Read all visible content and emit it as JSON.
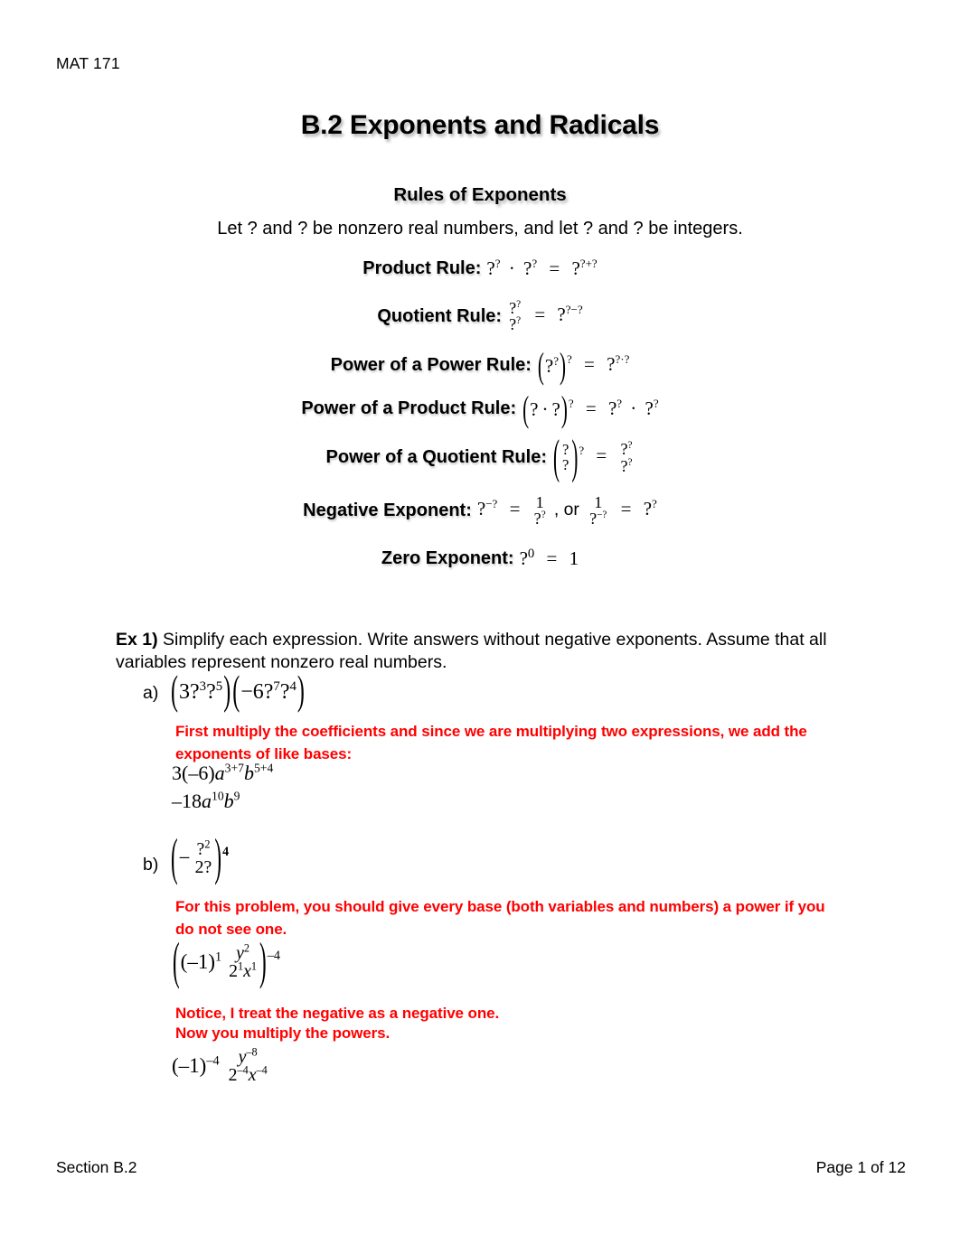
{
  "document": {
    "running_head": "MAT 171",
    "title": "B.2 Exponents and Radicals",
    "section_title": "Rules of Exponents",
    "footer_left": "Section B.2",
    "footer_right": "Page 1 of 12",
    "accent_color": "#ff0000"
  },
  "rules": {
    "intro": "Let ?  and ?  be nonzero real numbers, and let ?   and ?  be integers.",
    "product": {
      "label": "Product Rule:",
      "expression": "?? · ?? = ??+?",
      "base": "?",
      "exp1": "?",
      "exp2": "?",
      "result_base": "?",
      "result_exp": "?+?"
    },
    "quotient": {
      "label": "Quotient Rule:",
      "numerator_base": "?",
      "numerator_exp": "?",
      "denominator_base": "?",
      "denominator_exp": "?",
      "result_base": "?",
      "result_exp": "?−?"
    },
    "power_of_power": {
      "label": "Power of a Power Rule:",
      "inner_base": "?",
      "inner_exp": "?",
      "outer_exp": "?",
      "result_base": "?",
      "result_exp": "?·?"
    },
    "power_of_product": {
      "label": "Power of a Product Rule:",
      "factor1": "?",
      "factor2": "?",
      "outer_exp": "?",
      "result_base1": "?",
      "result_exp1": "?",
      "result_base2": "?",
      "result_exp2": "?"
    },
    "power_of_quotient": {
      "label": "Power of a Quotient Rule:",
      "numerator": "?",
      "denominator": "?",
      "outer_exp": "?",
      "result_num_base": "?",
      "result_num_exp": "?",
      "result_den_base": "?",
      "result_den_exp": "?"
    },
    "negative_exponent": {
      "label": "Negative Exponent:",
      "lhs_base": "?",
      "lhs_exp": "−?",
      "frac1_num": "1",
      "frac1_den_base": "?",
      "frac1_den_exp": "?",
      "connector": ", or",
      "frac2_num": "1",
      "frac2_den_base": "?",
      "frac2_den_exp": "−?",
      "rhs_base": "?",
      "rhs_exp": "?"
    },
    "zero_exponent": {
      "label": "Zero Exponent:",
      "base": "?",
      "exp": "0",
      "value": "1"
    },
    "equals": "=",
    "dot": "·",
    "comma_or": ", or"
  },
  "example": {
    "label": "Ex 1)",
    "instructions": " Simplify each expression.  Write answers without negative exponents.  Assume that all variables represent nonzero real numbers.",
    "parts": [
      {
        "label": "a)",
        "problem": {
          "factor1_coeff": "3",
          "factor1_v1": "?",
          "factor1_e1": "3",
          "factor1_v2": "?",
          "factor1_e2": "5",
          "factor2_coeff": "−6",
          "factor2_v1": "?",
          "factor2_e1": "7",
          "factor2_v2": "?",
          "factor2_e2": "4"
        },
        "note": "First multiply the coefficients and since we are multiplying two expressions, we add the exponents of like bases:",
        "work": [
          {
            "coeff": "3(–6)",
            "v1": "a",
            "e1": "3+7",
            "v2": "b",
            "e2": "5+4"
          },
          {
            "coeff": "–18",
            "v1": "a",
            "e1": "10",
            "v2": "b",
            "e2": "9"
          }
        ]
      },
      {
        "label": "b)",
        "problem": {
          "sign": "−",
          "num_base": "?",
          "num_exp": "2",
          "den_coeff": "2",
          "den_base": "?",
          "outer_exp": "4"
        },
        "note": "For this problem, you should give every base (both variables and numbers) a power if you do not see one.",
        "work_step1": {
          "sign_base": "(–1)",
          "sign_exp": "1",
          "num_base": "y",
          "num_exp": "2",
          "den_coeff": "2",
          "den_coeff_exp": "1",
          "den_base": "x",
          "den_base_exp": "1",
          "outer_exp": "–4"
        },
        "note2_line1": "Notice, I treat the negative as a negative one.",
        "note2_line2": "Now you multiply the powers.",
        "work_step2": {
          "sign_base": "(–1)",
          "sign_exp": "–4",
          "num_base": "y",
          "num_exp": "–8",
          "den_coeff": "2",
          "den_coeff_exp": "–4",
          "den_base": "x",
          "den_base_exp": "–4"
        }
      }
    ]
  }
}
